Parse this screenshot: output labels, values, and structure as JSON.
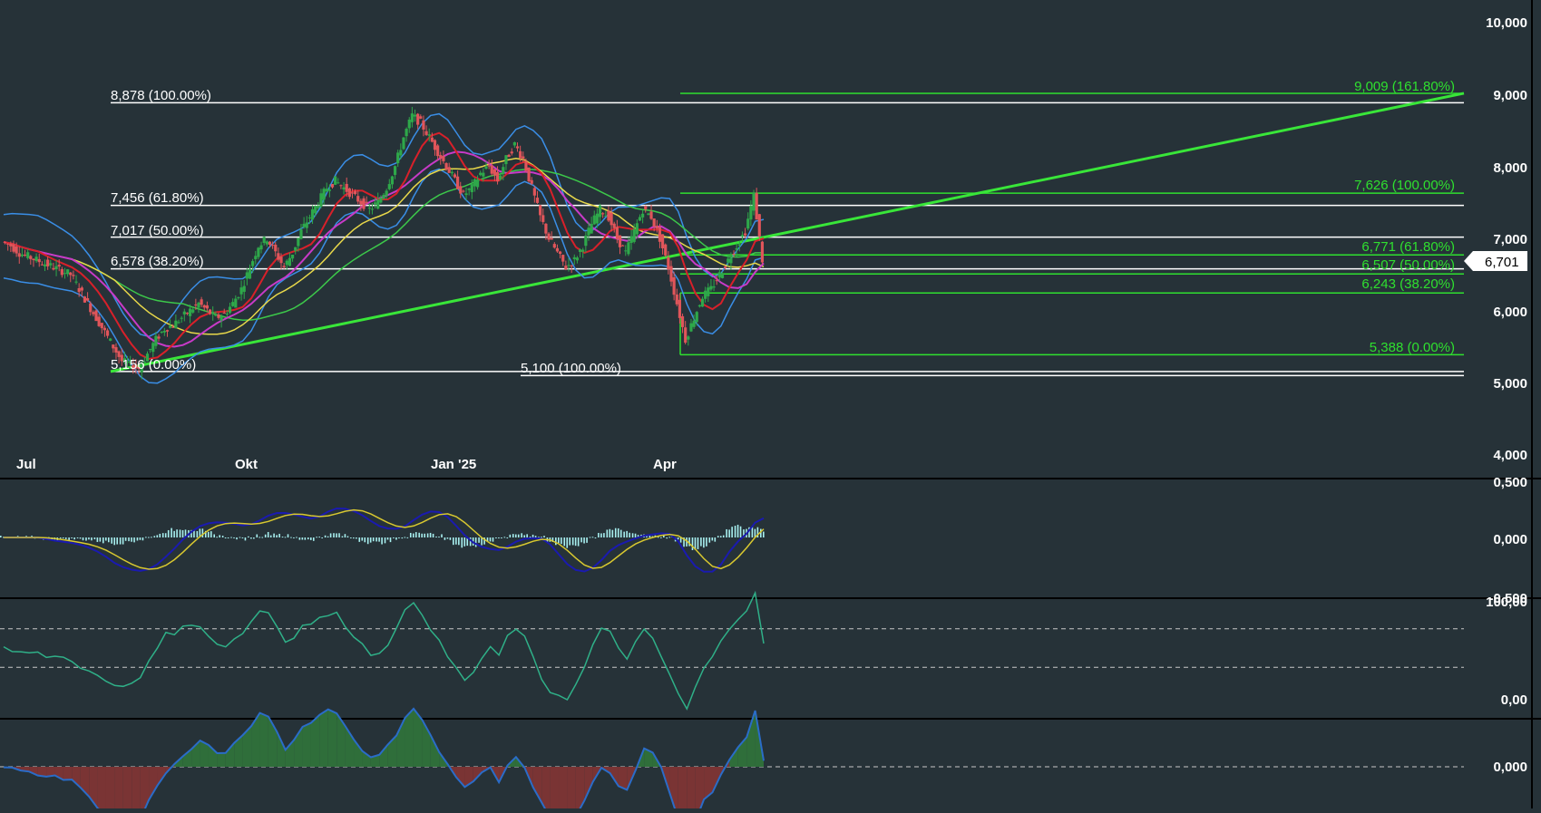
{
  "chart_data": [
    {
      "type": "candlestick",
      "panel": "price",
      "x_ticks": [
        "Jul",
        "Okt",
        "Jan '25",
        "Apr"
      ],
      "y_ticks": [
        "10,000",
        "9,000",
        "8,000",
        "7,000",
        "6,000",
        "5,000",
        "4,000"
      ],
      "ylim": [
        4000,
        10200
      ],
      "last_price": "6,701",
      "fib_white": [
        {
          "label": "8,878 (100.00%)",
          "value": 8878
        },
        {
          "label": "7,456 (61.80%)",
          "value": 7456
        },
        {
          "label": "7,017 (50.00%)",
          "value": 7017
        },
        {
          "label": "6,578 (38.20%)",
          "value": 6578
        },
        {
          "label": "5,156 (0.00%)",
          "value": 5156
        }
      ],
      "fib_overlap_label": "5,100 (100.00%)",
      "fib_green": [
        {
          "label": "9,009 (161.80%)",
          "value": 9009
        },
        {
          "label": "7,626 (100.00%)",
          "value": 7626
        },
        {
          "label": "6,771 (61.80%)",
          "value": 6771
        },
        {
          "label": "6,507 (50.00%)",
          "value": 6507
        },
        {
          "label": "6,243 (38.20%)",
          "value": 6243
        },
        {
          "label": "5,388 (0.00%)",
          "value": 5388
        }
      ],
      "close_series": [
        6950,
        6900,
        6800,
        6750,
        6700,
        6650,
        6600,
        6550,
        6500,
        6300,
        6100,
        5900,
        5700,
        5500,
        5300,
        5250,
        5200,
        5400,
        5600,
        5750,
        5800,
        5900,
        6000,
        6100,
        6000,
        5900,
        5950,
        6100,
        6300,
        6600,
        6900,
        7000,
        6800,
        6600,
        6800,
        7100,
        7300,
        7500,
        7700,
        7800,
        7700,
        7600,
        7500,
        7400,
        7500,
        7700,
        8000,
        8400,
        8700,
        8600,
        8400,
        8200,
        8000,
        7800,
        7600,
        7700,
        7900,
        8000,
        7800,
        8100,
        8300,
        8100,
        7700,
        7300,
        7000,
        6800,
        6600,
        6700,
        6900,
        7200,
        7400,
        7300,
        7000,
        6800,
        7100,
        7400,
        7300,
        7000,
        6600,
        6100,
        5600,
        5900,
        6200,
        6300,
        6500,
        6700,
        6900,
        7100,
        7600,
        6701
      ],
      "macd_ylim": [
        -0.5,
        0.5
      ],
      "macd_ticks": [
        "0,500",
        "0,000",
        "-0,500"
      ],
      "rsi_ticks": [
        "100,00",
        "0,00"
      ],
      "osc_ticks": [
        "0,000"
      ]
    }
  ]
}
